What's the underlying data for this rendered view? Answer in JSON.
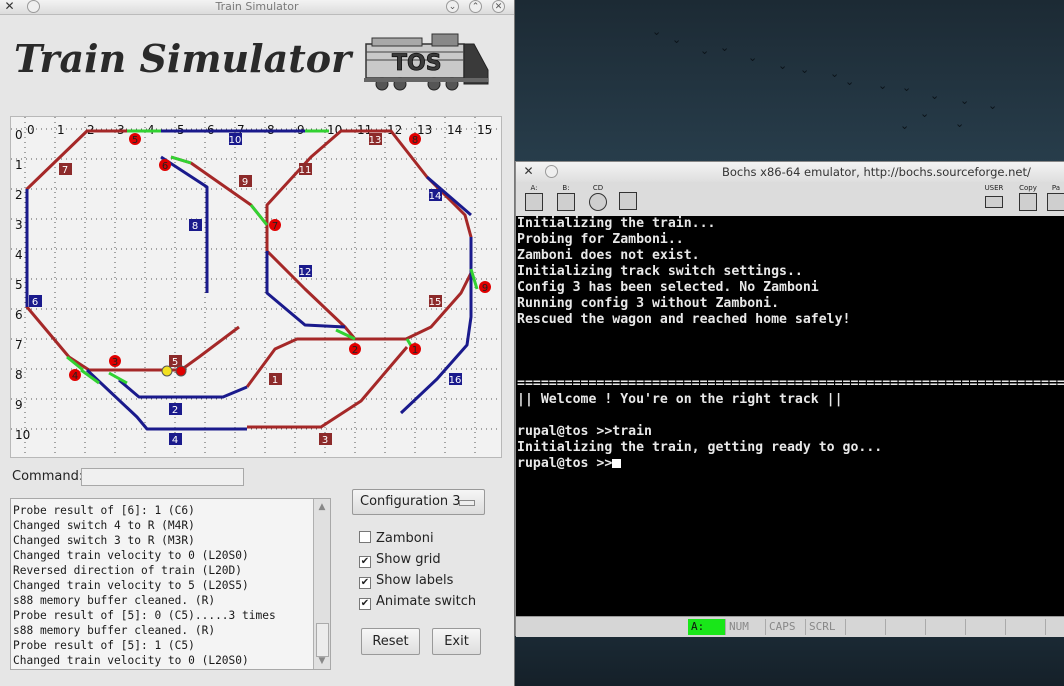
{
  "sim": {
    "window_title": "Train Simulator",
    "app_title": "Train Simulator",
    "logo_text": "TOS",
    "board": {
      "columns": [
        "0",
        "1",
        "2",
        "3",
        "4",
        "5",
        "6",
        "7",
        "8",
        "9",
        "10",
        "11",
        "12",
        "13",
        "14",
        "15"
      ],
      "rows": [
        "0",
        "1",
        "2",
        "3",
        "4",
        "5",
        "6",
        "7",
        "8",
        "9",
        "10"
      ],
      "contacts": [
        "1",
        "2",
        "3",
        "4",
        "5",
        "6",
        "7",
        "8",
        "9",
        "10",
        "11",
        "12",
        "13",
        "14",
        "15",
        "16"
      ],
      "switches": [
        "1",
        "2",
        "3",
        "4",
        "5",
        "6",
        "7",
        "8",
        "9"
      ],
      "colors": {
        "track_red": "#a52828",
        "track_blue": "#1a1a8c",
        "switch_green": "#32d232",
        "contact_red": "#e00000"
      }
    },
    "command_label": "Command:",
    "command_value": "",
    "log": [
      "Probe result of [6]: 1 (C6)",
      "Changed switch 4 to R (M4R)",
      "Changed switch 3 to R (M3R)",
      "Changed train velocity to 0 (L20S0)",
      "Reversed direction of train (L20D)",
      "Changed train velocity to 5 (L20S5)",
      "s88 memory buffer cleaned. (R)",
      "Probe result of [5]: 0 (C5).....3 times",
      "s88 memory buffer cleaned. (R)",
      "Probe result of [5]: 1 (C5)",
      "Changed train velocity to 0 (L20S0)"
    ],
    "config_selected": "Configuration 3",
    "options": [
      {
        "label": "Zamboni",
        "checked": false
      },
      {
        "label": "Show grid",
        "checked": true
      },
      {
        "label": "Show labels",
        "checked": true
      },
      {
        "label": "Animate switch",
        "checked": true
      }
    ],
    "reset_label": "Reset",
    "exit_label": "Exit"
  },
  "bochs": {
    "title": "Bochs x86-64 emulator, http://bochs.sourceforge.net/",
    "toolbar": [
      "A:",
      "B:",
      "CD",
      "USER",
      "Copy",
      "Pa"
    ],
    "screen_lines": [
      "Initializing the train...",
      "Probing for Zamboni..",
      "Zamboni does not exist.",
      "Initializing track switch settings..",
      "Config 3 has been selected. No Zamboni",
      "Running config 3 without Zamboni.",
      "Rescued the wagon and reached home safely!",
      "",
      "",
      "",
      "========================================================================",
      "|| Welcome ! You're on the right track ||",
      "",
      "rupal@tos >>train",
      "Initializing the train, getting ready to go...",
      "rupal@tos >>"
    ],
    "status": [
      "A:",
      "NUM",
      "CAPS",
      "SCRL",
      "",
      "",
      "",
      "",
      ""
    ]
  }
}
